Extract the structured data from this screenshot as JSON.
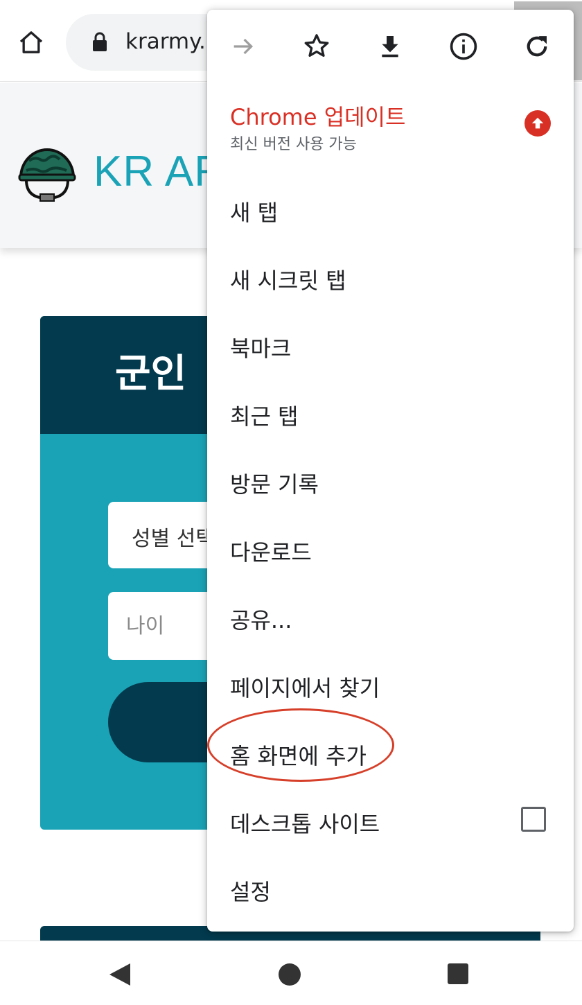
{
  "browser": {
    "url": "krarmy.r"
  },
  "page": {
    "site_title": "KR AR",
    "card_title": "군인 ",
    "gender_select_value": "성별 선택",
    "age_placeholder": "나이"
  },
  "menu": {
    "update": {
      "title": "Chrome 업데이트",
      "subtitle": "최신 버전 사용 가능"
    },
    "items": [
      {
        "label": "새 탭"
      },
      {
        "label": "새 시크릿 탭"
      },
      {
        "label": "북마크"
      },
      {
        "label": "최근 탭"
      },
      {
        "label": "방문 기록"
      },
      {
        "label": "다운로드"
      },
      {
        "label": "공유..."
      },
      {
        "label": "페이지에서 찾기"
      },
      {
        "label": "홈 화면에 추가"
      },
      {
        "label": "데스크톱 사이트"
      },
      {
        "label": "설정"
      }
    ],
    "desktop_site_checked": false
  },
  "icons": {
    "toolbar": [
      "home-icon",
      "lock-icon"
    ],
    "menu_bar": [
      "forward-arrow-icon",
      "star-icon",
      "download-icon",
      "info-icon",
      "reload-icon"
    ],
    "nav": [
      "back-triangle-icon",
      "home-circle-icon",
      "recents-square-icon"
    ]
  },
  "colors": {
    "accent_teal": "#1aa3b6",
    "dark_navy": "#033a4e",
    "update_red": "#d93025",
    "highlight_red": "#d6402a"
  }
}
